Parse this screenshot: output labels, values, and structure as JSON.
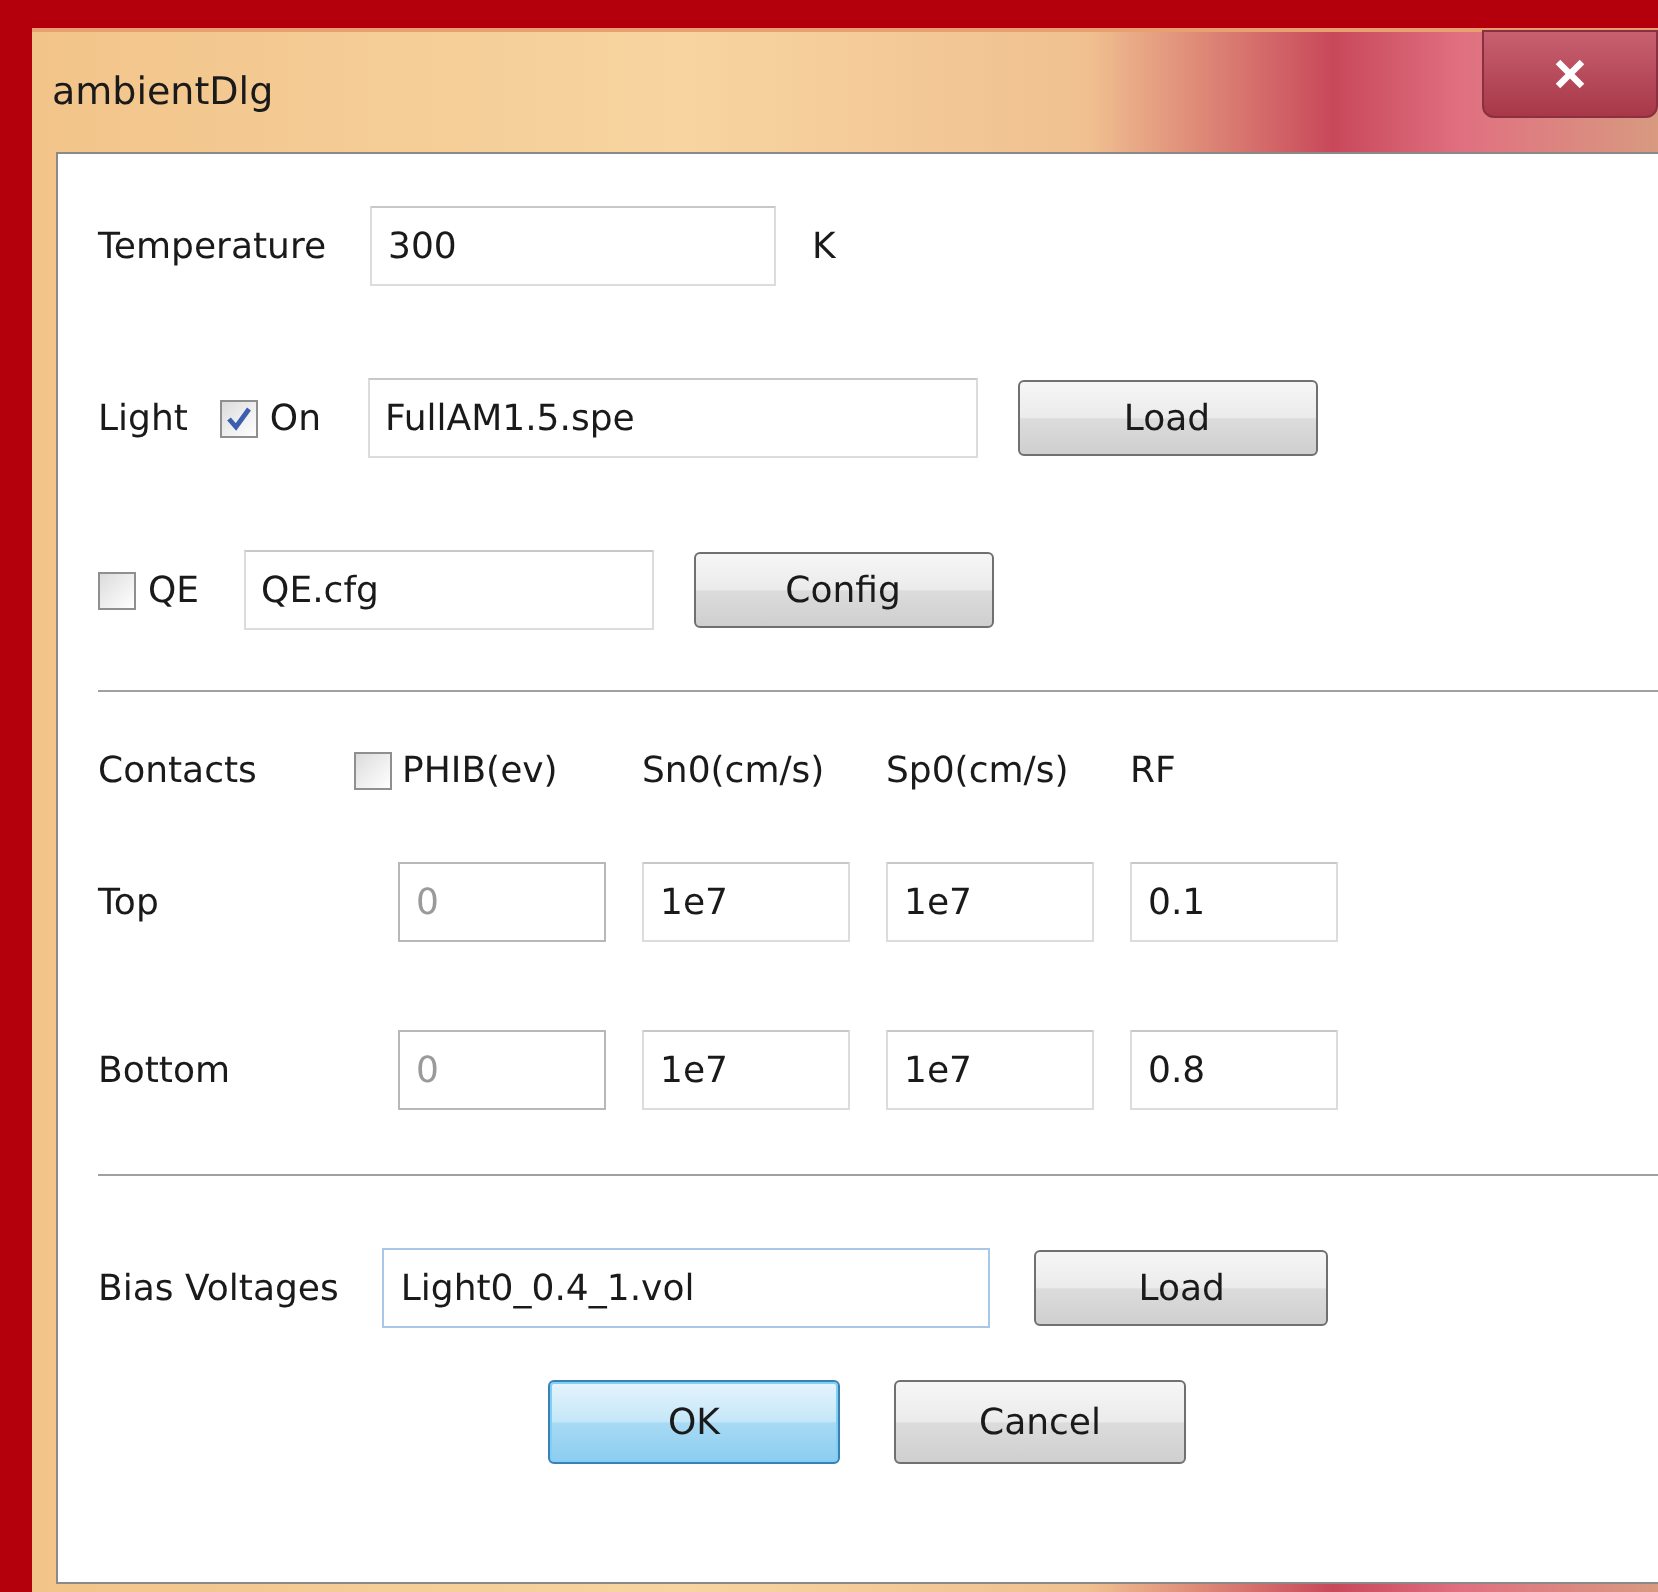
{
  "window": {
    "title": "ambientDlg"
  },
  "temperature": {
    "label": "Temperature",
    "value": "300",
    "unit": "K"
  },
  "light": {
    "label": "Light",
    "on": {
      "label": "On",
      "checked": true
    },
    "file": "FullAM1.5.spe",
    "button": "Load"
  },
  "qe": {
    "checkbox": {
      "label": "QE",
      "checked": false
    },
    "file": "QE.cfg",
    "button": "Config"
  },
  "contacts": {
    "label": "Contacts",
    "phib": {
      "label": "PHIB(ev)",
      "checked": false
    },
    "columns": [
      "Sn0(cm/s)",
      "Sp0(cm/s)",
      "RF"
    ],
    "rows": [
      {
        "label": "Top",
        "phib": "0",
        "values": [
          "1e7",
          "1e7",
          "0.1"
        ]
      },
      {
        "label": "Bottom",
        "phib": "0",
        "values": [
          "1e7",
          "1e7",
          "0.8"
        ]
      }
    ]
  },
  "bias": {
    "label": "Bias Voltages",
    "value": "Light0_0.4_1.vol",
    "button": "Load"
  },
  "buttons": [
    {
      "label": "OK",
      "default": true
    },
    {
      "label": "Cancel",
      "default": false
    }
  ]
}
